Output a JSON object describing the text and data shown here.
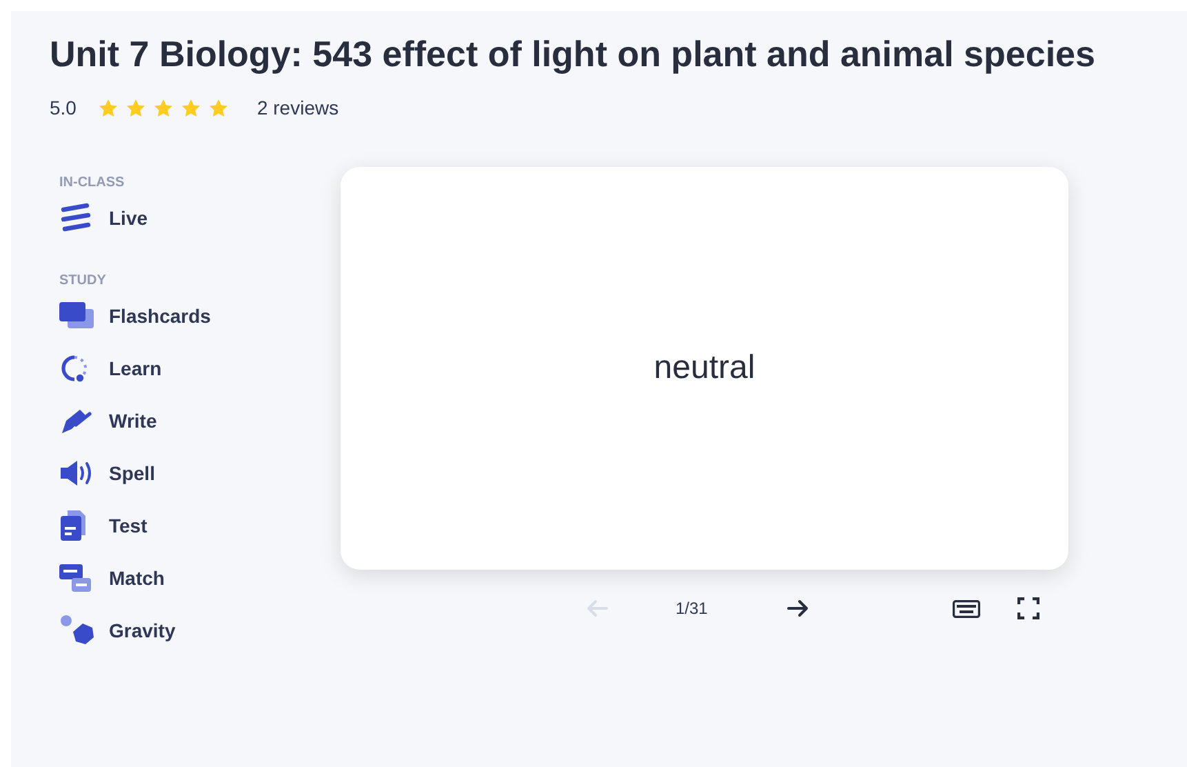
{
  "title": "Unit 7 Biology: 543 effect of light on plant and animal species",
  "rating": {
    "score": "5.0",
    "stars": 5,
    "reviews": "2 reviews"
  },
  "sidebar": [
    {
      "heading": "IN-CLASS",
      "items": [
        {
          "label": "Live",
          "kind": "live"
        }
      ]
    },
    {
      "heading": "STUDY",
      "items": [
        {
          "label": "Flashcards",
          "kind": "flashcards"
        },
        {
          "label": "Learn",
          "kind": "learn"
        },
        {
          "label": "Write",
          "kind": "write"
        },
        {
          "label": "Spell",
          "kind": "spell"
        },
        {
          "label": "Test",
          "kind": "test"
        },
        {
          "label": "Match",
          "kind": "match"
        },
        {
          "label": "Gravity",
          "kind": "gravity"
        }
      ]
    }
  ],
  "card": {
    "text": "neutral"
  },
  "nav": {
    "prev_disabled": true,
    "counter": "1/31"
  }
}
